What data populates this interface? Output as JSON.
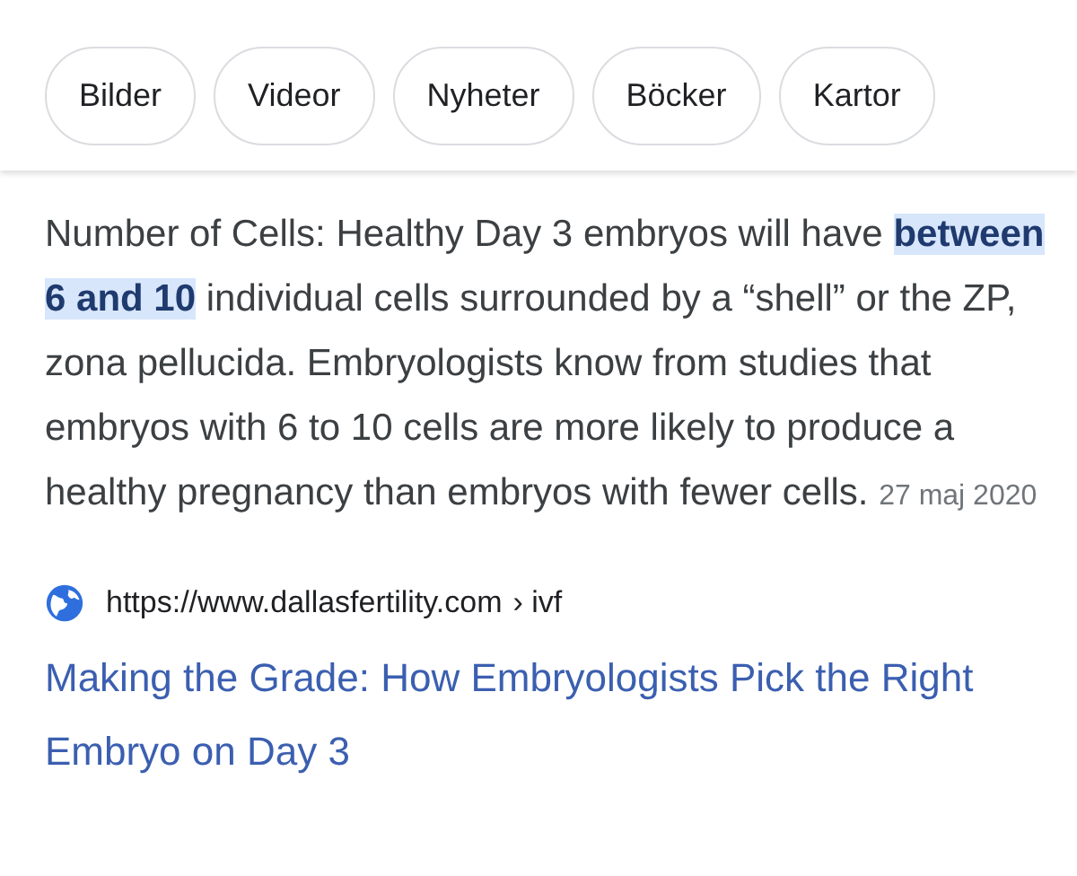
{
  "chips": [
    {
      "label": "Bilder"
    },
    {
      "label": "Videor"
    },
    {
      "label": "Nyheter"
    },
    {
      "label": "Böcker"
    },
    {
      "label": "Kartor"
    }
  ],
  "snippet": {
    "before": "Number of Cells: Healthy Day 3 embryos will have ",
    "highlight": "between 6 and 10",
    "after": " individual cells surrounded by a “shell” or the ZP, zona pellucida. Embryologists know from studies that embryos with 6 to 10 cells are more likely to produce a healthy pregnancy than embryos with fewer cells.",
    "date": "27 maj 2020"
  },
  "result": {
    "url": "https://www.dallasfertility.com",
    "breadcrumb": "› ivf",
    "title": "Making the Grade: How Embryologists Pick the Right Embryo on Day 3"
  }
}
